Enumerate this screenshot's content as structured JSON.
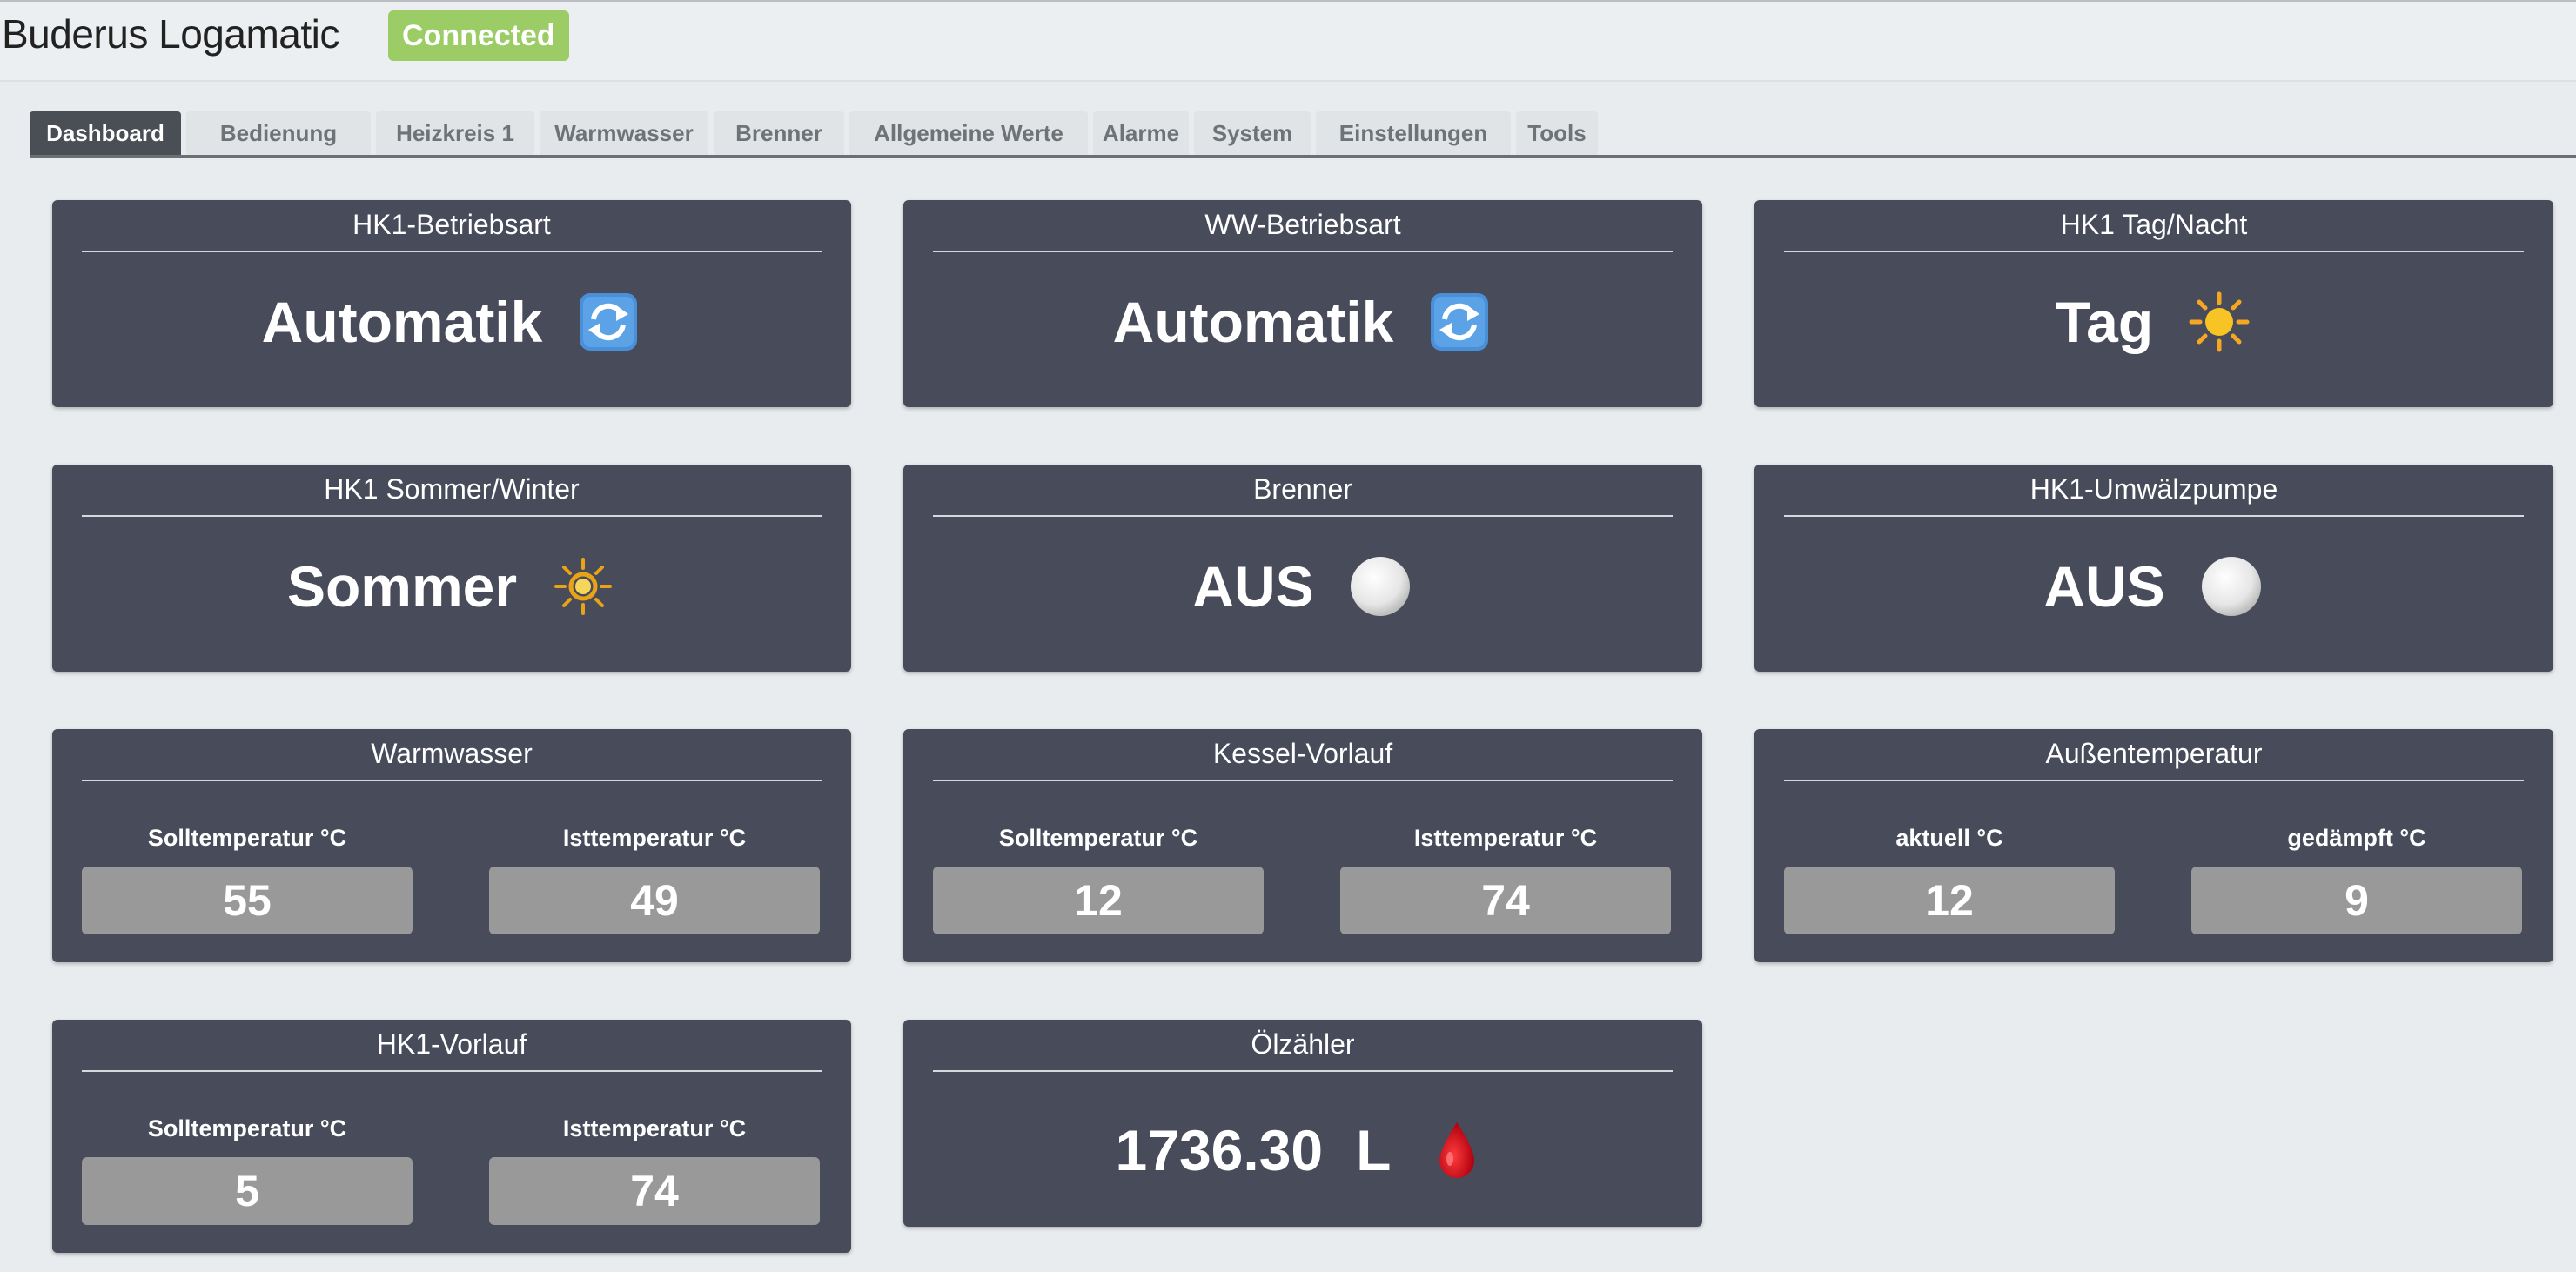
{
  "app": {
    "title": "Buderus Logamatic",
    "status": "Connected"
  },
  "tabs": [
    {
      "label": "Dashboard",
      "active": true
    },
    {
      "label": "Bedienung"
    },
    {
      "label": "Heizkreis 1"
    },
    {
      "label": "Warmwasser"
    },
    {
      "label": "Brenner"
    },
    {
      "label": "Allgemeine Werte"
    },
    {
      "label": "Alarme"
    },
    {
      "label": "System"
    },
    {
      "label": "Einstellungen"
    },
    {
      "label": "Tools"
    }
  ],
  "cards": {
    "hk1_betriebsart": {
      "title": "HK1-Betriebsart",
      "value": "Automatik",
      "icon": "refresh-icon"
    },
    "ww_betriebsart": {
      "title": "WW-Betriebsart",
      "value": "Automatik",
      "icon": "refresh-icon"
    },
    "hk1_tag_nacht": {
      "title": "HK1 Tag/Nacht",
      "value": "Tag",
      "icon": "sun-icon"
    },
    "hk1_sommer_winter": {
      "title": "HK1 Sommer/Winter",
      "value": "Sommer",
      "icon": "bright-sun-icon"
    },
    "brenner": {
      "title": "Brenner",
      "value": "AUS",
      "icon": "white-circle-icon"
    },
    "hk1_umwaelzpumpe": {
      "title": "HK1-Umwälzpumpe",
      "value": "AUS",
      "icon": "white-circle-icon"
    },
    "warmwasser": {
      "title": "Warmwasser",
      "left_label": "Solltemperatur °C",
      "left_value": "55",
      "right_label": "Isttemperatur °C",
      "right_value": "49"
    },
    "kessel_vorlauf": {
      "title": "Kessel-Vorlauf",
      "left_label": "Solltemperatur °C",
      "left_value": "12",
      "right_label": "Isttemperatur °C",
      "right_value": "74"
    },
    "aussentemperatur": {
      "title": "Außentemperatur",
      "left_label": "aktuell °C",
      "left_value": "12",
      "right_label": "gedämpft °C",
      "right_value": "9"
    },
    "hk1_vorlauf": {
      "title": "HK1-Vorlauf",
      "left_label": "Solltemperatur °C",
      "left_value": "5",
      "right_label": "Isttemperatur °C",
      "right_value": "74"
    },
    "oelzaehler": {
      "title": "Ölzähler",
      "value": "1736.30",
      "unit": "L",
      "icon": "oil-drop-icon"
    }
  },
  "colors": {
    "card_bg": "#474b5a",
    "value_box_bg": "#999999",
    "badge_bg": "#9ccc65",
    "page_bg": "#e9ecee"
  }
}
